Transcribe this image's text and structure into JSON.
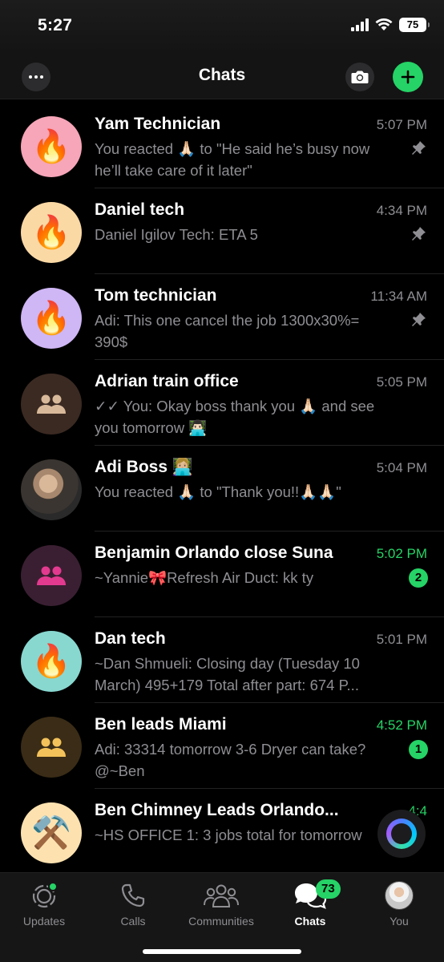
{
  "status": {
    "time": "5:27",
    "battery": "75"
  },
  "header": {
    "title": "Chats"
  },
  "chats": [
    {
      "name": "Yam Technician",
      "time": "5:07 PM",
      "preview": "You reacted 🙏🏻 to \"He said he’s busy now he’ll take care of it later\"",
      "avatar": "🔥",
      "pinned": true
    },
    {
      "name": "Daniel tech",
      "time": "4:34 PM",
      "preview": "Daniel Igilov Tech: ETA 5",
      "avatar": "🔥",
      "pinned": true
    },
    {
      "name": "Tom technician",
      "time": "11:34 AM",
      "preview": "Adi: This one cancel the job 1300x30%= 390$",
      "avatar": "🔥",
      "pinned": true
    },
    {
      "name": "Adrian train office",
      "time": "5:05 PM",
      "preview": "✓✓ You: Okay boss thank you 🙏🏻 and see you tomorrow 👨🏻‍💻",
      "avatar": "group"
    },
    {
      "name": "Adi Boss 👩🏼‍💻",
      "time": "5:04 PM",
      "preview": "You reacted 🙏🏻 to \"Thank you!!🙏🏻🙏🏻\"",
      "avatar": "photo"
    },
    {
      "name": "Benjamin Orlando close Suna",
      "time": "5:02 PM",
      "preview": "~Yannie🎀Refresh Air Duct: kk ty",
      "avatar": "group",
      "unread": "2"
    },
    {
      "name": "Dan tech",
      "time": "5:01 PM",
      "preview": "~Dan Shmueli: Closing day (Tuesday 10 March) 495+179 Total after part: 674 P...",
      "avatar": "🔥"
    },
    {
      "name": "Ben leads Miami",
      "time": "4:52 PM",
      "preview": "Adi: 33314 tomorrow 3-6 Dryer can take? @~Ben",
      "avatar": "group",
      "unread": "1"
    },
    {
      "name": "Ben Chimney Leads Orlando...",
      "time": "4:4",
      "preview": "~HS OFFICE 1: 3 jobs total for tomorrow",
      "avatar": "⚒️"
    }
  ],
  "tabs": [
    {
      "label": "Updates",
      "icon": "updates-icon"
    },
    {
      "label": "Calls",
      "icon": "phone-icon"
    },
    {
      "label": "Communities",
      "icon": "communities-icon"
    },
    {
      "label": "Chats",
      "icon": "chats-icon",
      "badge": "73"
    },
    {
      "label": "You",
      "icon": "profile-avatar"
    }
  ],
  "colors": {
    "accent": "#25d366",
    "background": "#000000",
    "muted": "#8e8e93"
  }
}
